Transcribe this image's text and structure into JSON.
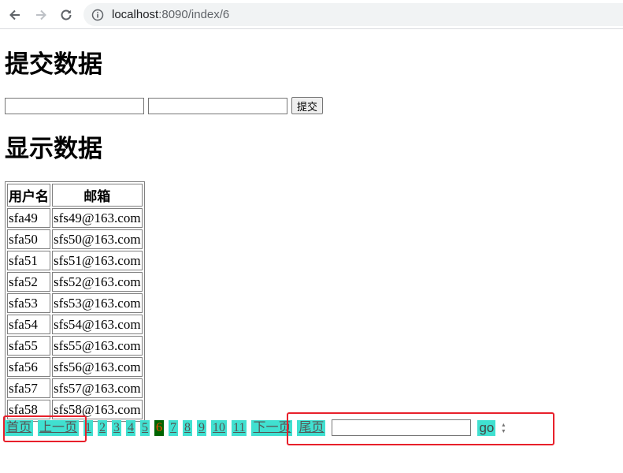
{
  "browser": {
    "url_host": "localhost",
    "url_path": ":8090/index/6"
  },
  "form_section": {
    "title": "提交数据",
    "submit_label": "提交"
  },
  "table_section": {
    "title": "显示数据",
    "headers": [
      "用户名",
      "邮箱"
    ],
    "rows": [
      [
        "sfa49",
        "sfs49@163.com"
      ],
      [
        "sfa50",
        "sfs50@163.com"
      ],
      [
        "sfa51",
        "sfs51@163.com"
      ],
      [
        "sfa52",
        "sfs52@163.com"
      ],
      [
        "sfa53",
        "sfs53@163.com"
      ],
      [
        "sfa54",
        "sfs54@163.com"
      ],
      [
        "sfa55",
        "sfs55@163.com"
      ],
      [
        "sfa56",
        "sfs56@163.com"
      ],
      [
        "sfa57",
        "sfs57@163.com"
      ],
      [
        "sfa58",
        "sfs58@163.com"
      ]
    ]
  },
  "pagination": {
    "first": "首页",
    "prev": "上一页",
    "pages": [
      "1",
      "2",
      "3",
      "4",
      "5",
      "6",
      "7",
      "8",
      "9",
      "10",
      "11"
    ],
    "current": "6",
    "next": "下一页",
    "last": "尾页",
    "go": "go"
  },
  "colors": {
    "pager_bg": "#40e0d0",
    "current_bg": "#006400",
    "current_text": "#ff4500",
    "highlight": "#e8202b"
  }
}
